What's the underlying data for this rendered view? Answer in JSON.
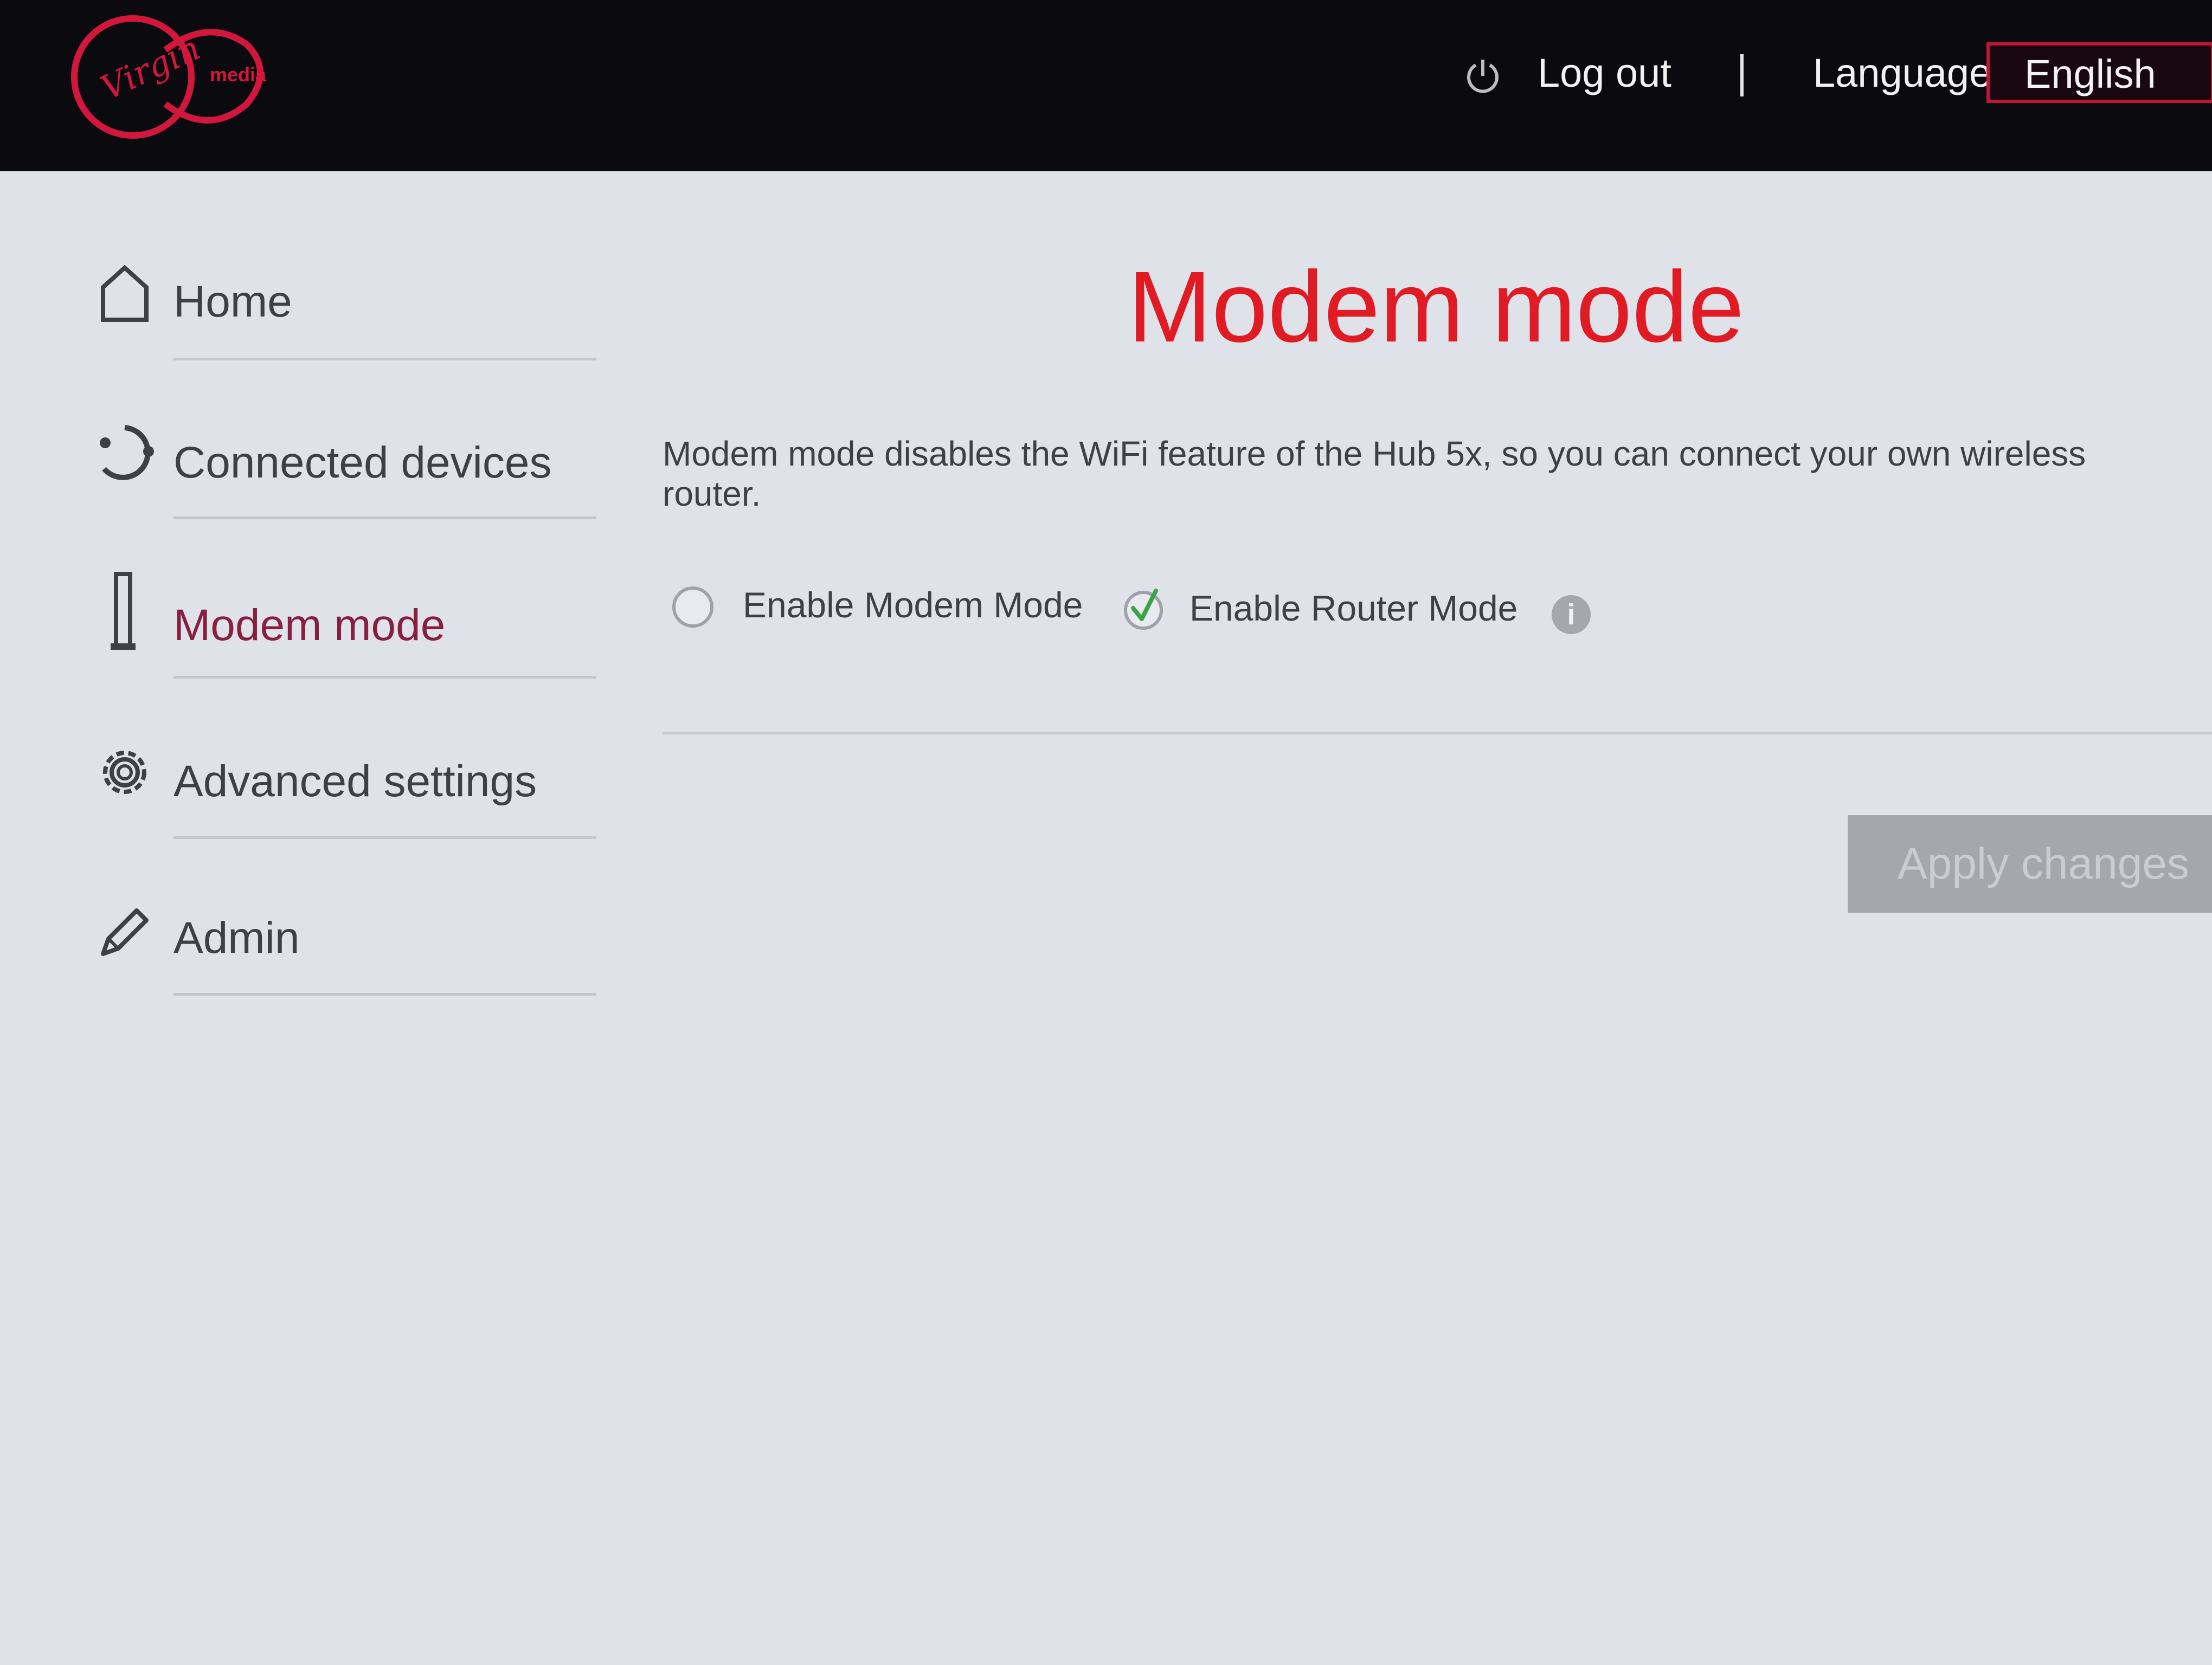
{
  "header": {
    "brand_name": "Virgin media",
    "logout_label": "Log out",
    "separator": "|",
    "language_label": "Language",
    "language_value": "English"
  },
  "sidebar": {
    "items": [
      {
        "label": "Home",
        "icon": "home-icon"
      },
      {
        "label": "Connected devices",
        "icon": "connected-devices-icon"
      },
      {
        "label": "Modem mode",
        "icon": "modem-icon",
        "active": true
      },
      {
        "label": "Advanced settings",
        "icon": "gear-icon"
      },
      {
        "label": "Admin",
        "icon": "pencil-icon"
      }
    ]
  },
  "main": {
    "title": "Modem mode",
    "description": "Modem mode disables the WiFi feature of the Hub 5x, so you can connect your own wireless router.",
    "options": [
      {
        "label": "Enable Modem Mode",
        "selected": false
      },
      {
        "label": "Enable Router Mode",
        "selected": true
      }
    ],
    "apply_label": "Apply changes"
  },
  "colors": {
    "header_bg": "#0a0a0f",
    "accent_red": "#e01b24",
    "active_nav": "#86203e",
    "check_green": "#3aa34a",
    "page_bg": "#dfe2e9"
  }
}
